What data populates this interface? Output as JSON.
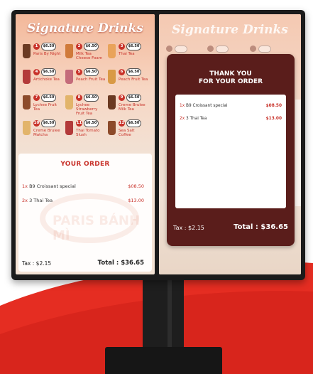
{
  "colors": {
    "accent_red": "#c8322a",
    "card_maroon": "#5a1d1b",
    "kiosk_frame": "#1b1b1b"
  },
  "left_screen": {
    "menu_title": "Signature Drinks",
    "items": [
      {
        "num": "1",
        "price": "$6.50",
        "name": "Paris By Night"
      },
      {
        "num": "2",
        "price": "$6.50",
        "name": "Milk Tea Cheese Foam"
      },
      {
        "num": "3",
        "price": "$6.50",
        "name": "Thai Tea"
      },
      {
        "num": "4",
        "price": "$6.50",
        "name": "Artichoke Tea"
      },
      {
        "num": "5",
        "price": "$6.50",
        "name": "Peach Fruit Tea"
      },
      {
        "num": "6",
        "price": "$6.50",
        "name": "Peach Fruit Tea"
      },
      {
        "num": "7",
        "price": "$6.50",
        "name": "Lychee Fruit Tea"
      },
      {
        "num": "8",
        "price": "$6.50",
        "name": "Lychee Strawberry Fruit Tea"
      },
      {
        "num": "9",
        "price": "$6.50",
        "name": "Creme Brulee Milk Tea"
      },
      {
        "num": "10",
        "price": "$6.50",
        "name": "Creme Brulee Matcha"
      },
      {
        "num": "11",
        "price": "$6.50",
        "name": "Thai Tomato Slush"
      },
      {
        "num": "12",
        "price": "$6.50",
        "name": "Sea Salt Coffee"
      }
    ],
    "order_heading": "YOUR ORDER",
    "watermark_text": "PARIS BÁNH MÌ",
    "order_lines": [
      {
        "qty": "1x",
        "name": "B9 Croissant special",
        "amount": "$08.50"
      },
      {
        "qty": "2x",
        "name": "3 Thai Tea",
        "amount": "$13.00"
      }
    ],
    "tax": "Tax : $2.15",
    "total": "Total : $36.65"
  },
  "right_screen": {
    "menu_title": "Signature Drinks",
    "thank_you_line1": "THANK YOU",
    "thank_you_line2": "FOR YOUR ORDER",
    "order_lines": [
      {
        "qty": "1x",
        "name": "B9 Croissant special",
        "amount": "$08.50"
      },
      {
        "qty": "2x",
        "name": "3 Thai Tea",
        "amount": "$13.00"
      }
    ],
    "tax": "Tax : $2.15",
    "total": "Total : $36.65"
  }
}
